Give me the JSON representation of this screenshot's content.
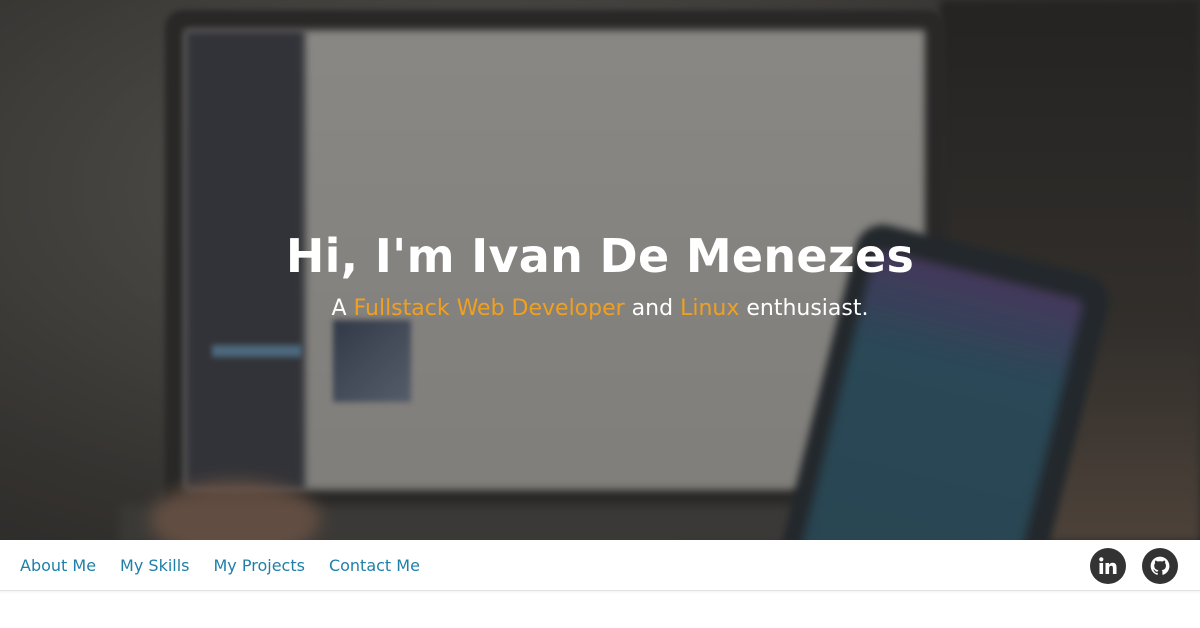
{
  "hero": {
    "greeting": "Hi, I'm Ivan De Menezes",
    "subtitle_prefix": "A ",
    "subtitle_role": "Fullstack Web Developer",
    "subtitle_middle": " and ",
    "subtitle_tech": "Linux",
    "subtitle_suffix": " enthusiast.",
    "accent_color": "#f0a020"
  },
  "nav": {
    "links": [
      {
        "label": "About Me"
      },
      {
        "label": "My Skills"
      },
      {
        "label": "My Projects"
      },
      {
        "label": "Contact Me"
      }
    ],
    "link_color": "#1f7fa8"
  },
  "social": {
    "icons": [
      "linkedin-icon",
      "github-icon"
    ]
  }
}
